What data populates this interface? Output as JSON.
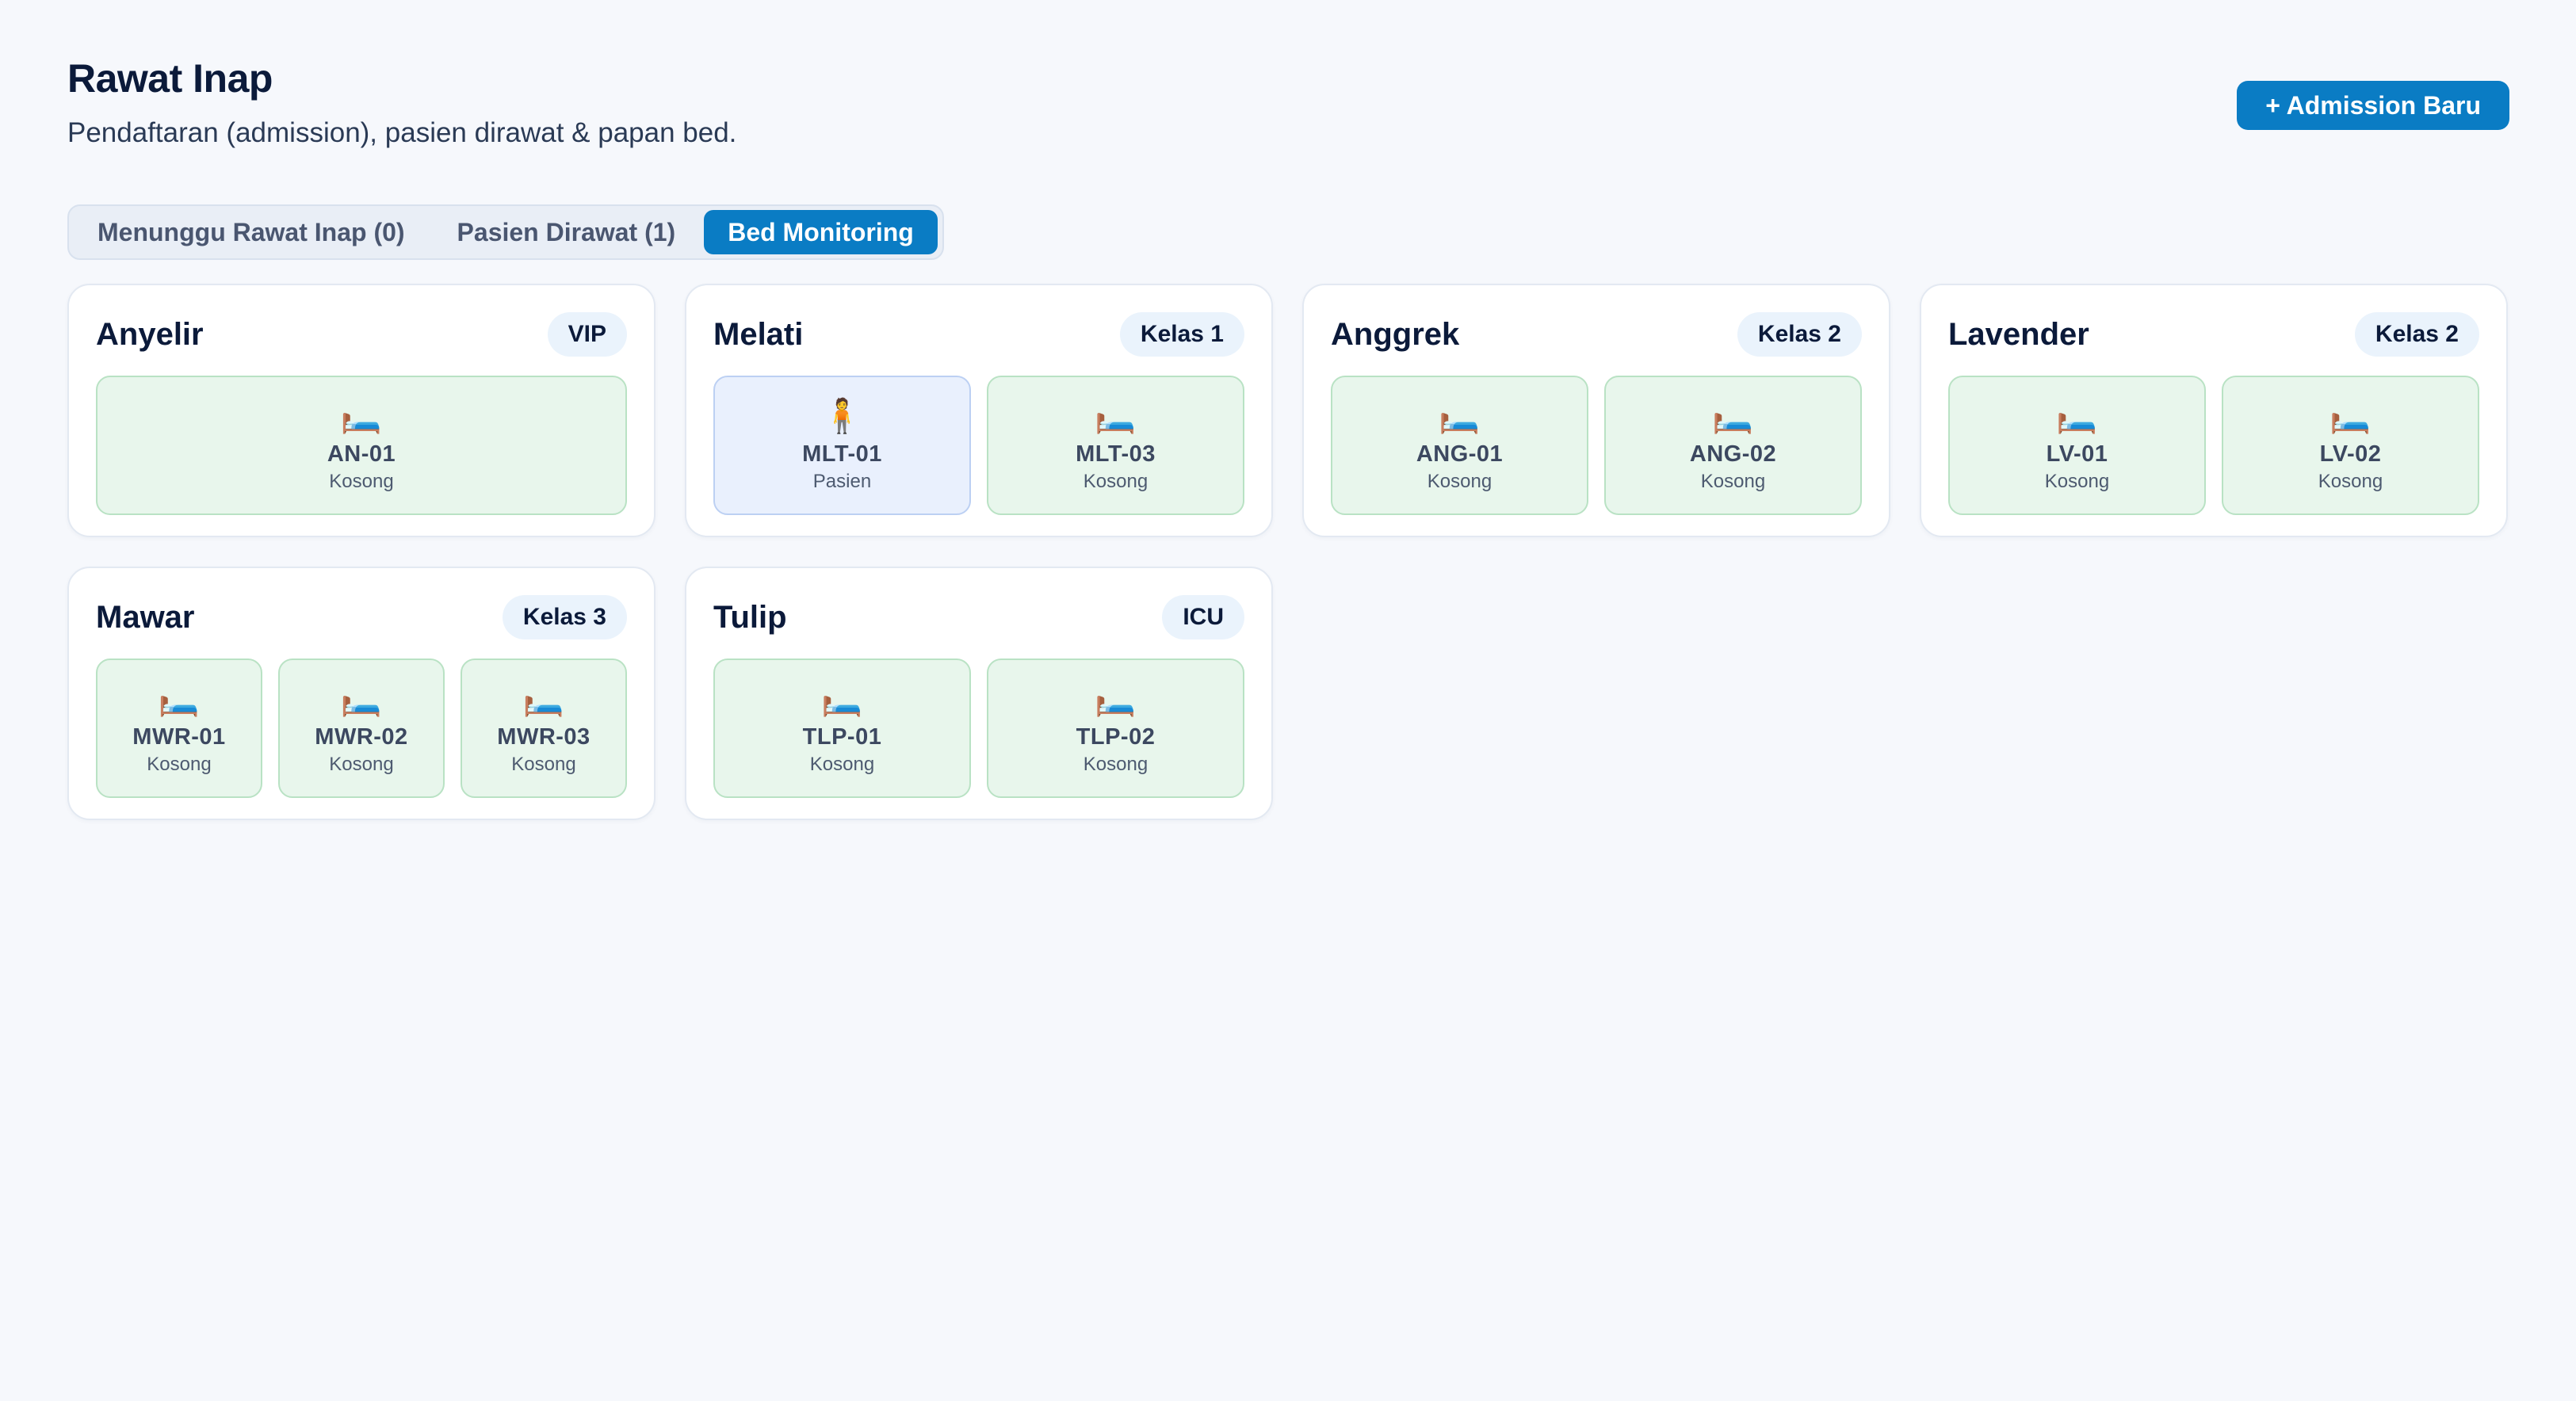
{
  "header": {
    "title": "Rawat Inap",
    "subtitle": "Pendaftaran (admission), pasien dirawat & papan bed."
  },
  "actions": {
    "admission_label": "+ Admission Baru"
  },
  "tabs": [
    {
      "label": "Menunggu Rawat Inap (0)",
      "active": false
    },
    {
      "label": "Pasien Dirawat (1)",
      "active": false
    },
    {
      "label": "Bed Monitoring",
      "active": true
    }
  ],
  "colors": {
    "accent": "#0a7cc4",
    "bed_empty": "#e8f6ec",
    "bed_occupied": "#e9f0fd"
  },
  "wards": [
    {
      "name": "Anyelir",
      "class": "VIP",
      "beds": [
        {
          "code": "AN-01",
          "status": "Kosong",
          "icon": "bed-icon"
        }
      ]
    },
    {
      "name": "Melati",
      "class": "Kelas 1",
      "beds": [
        {
          "code": "MLT-01",
          "status": "Pasien",
          "icon": "patient-icon"
        },
        {
          "code": "MLT-03",
          "status": "Kosong",
          "icon": "bed-icon"
        }
      ]
    },
    {
      "name": "Anggrek",
      "class": "Kelas 2",
      "beds": [
        {
          "code": "ANG-01",
          "status": "Kosong",
          "icon": "bed-icon"
        },
        {
          "code": "ANG-02",
          "status": "Kosong",
          "icon": "bed-icon"
        }
      ]
    },
    {
      "name": "Lavender",
      "class": "Kelas 2",
      "beds": [
        {
          "code": "LV-01",
          "status": "Kosong",
          "icon": "bed-icon"
        },
        {
          "code": "LV-02",
          "status": "Kosong",
          "icon": "bed-icon"
        }
      ]
    },
    {
      "name": "Mawar",
      "class": "Kelas 3",
      "beds": [
        {
          "code": "MWR-01",
          "status": "Kosong",
          "icon": "bed-icon"
        },
        {
          "code": "MWR-02",
          "status": "Kosong",
          "icon": "bed-icon"
        },
        {
          "code": "MWR-03",
          "status": "Kosong",
          "icon": "bed-icon"
        }
      ]
    },
    {
      "name": "Tulip",
      "class": "ICU",
      "beds": [
        {
          "code": "TLP-01",
          "status": "Kosong",
          "icon": "bed-icon"
        },
        {
          "code": "TLP-02",
          "status": "Kosong",
          "icon": "bed-icon"
        }
      ]
    }
  ]
}
